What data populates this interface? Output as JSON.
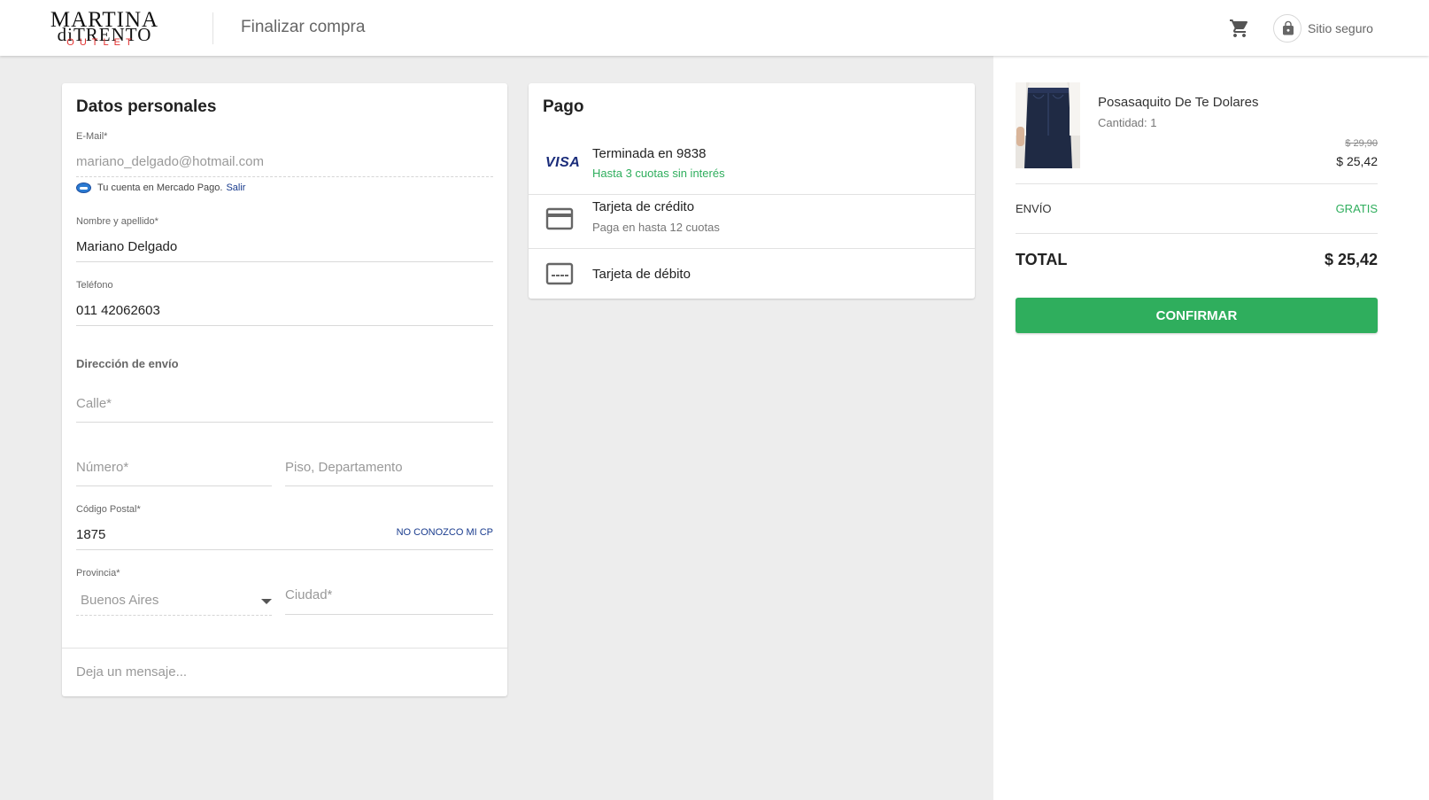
{
  "header": {
    "logo": {
      "line1": "MARTINA",
      "line2": "diTRENTO",
      "line3": "OUTLET"
    },
    "title": "Finalizar compra",
    "cart_icon": "shopping-cart-icon",
    "lock_icon": "lock-icon",
    "secure_label": "Sitio seguro"
  },
  "personal": {
    "title": "Datos personales",
    "email": {
      "label": "E-Mail*",
      "value": "mariano_delgado@hotmail.com"
    },
    "mercadopago": {
      "text": "Tu cuenta en Mercado Pago.",
      "logout": "Salir"
    },
    "name": {
      "label": "Nombre y apellido*",
      "value": "Mariano Delgado"
    },
    "phone": {
      "label": "Teléfono",
      "value": "011 42062603"
    },
    "address_title": "Dirección de envío",
    "street": {
      "placeholder": "Calle*"
    },
    "number": {
      "placeholder": "Número*"
    },
    "floor": {
      "placeholder": "Piso, Departamento"
    },
    "postal": {
      "label": "Código Postal*",
      "value": "1875",
      "link": "NO CONOZCO MI CP"
    },
    "province": {
      "label": "Provincia*",
      "value": "Buenos Aires"
    },
    "city": {
      "placeholder": "Ciudad*"
    },
    "message": {
      "placeholder": "Deja un mensaje..."
    }
  },
  "payment": {
    "title": "Pago",
    "options": [
      {
        "icon": "visa-icon",
        "icon_text": "VISA",
        "title": "Terminada en 9838",
        "subtitle": "Hasta 3 cuotas sin interés"
      },
      {
        "icon": "credit-card-icon",
        "title": "Tarjeta de crédito",
        "subtitle": "Paga en hasta 12 cuotas"
      },
      {
        "icon": "debit-card-icon",
        "title": "Tarjeta de débito"
      }
    ]
  },
  "summary": {
    "product": {
      "name": "Posasaquito De Te Dolares",
      "quantity": "Cantidad: 1",
      "price_old": "$ 29,90",
      "price_new": "$ 25,42"
    },
    "shipping": {
      "label": "ENVÍO",
      "value": "GRATIS"
    },
    "total": {
      "label": "TOTAL",
      "value": "$ 25,42"
    },
    "confirm_label": "CONFIRMAR"
  },
  "colors": {
    "accent_green": "#2fae5d",
    "link_blue": "#1a3c8e",
    "brand_red": "#e2302f"
  }
}
